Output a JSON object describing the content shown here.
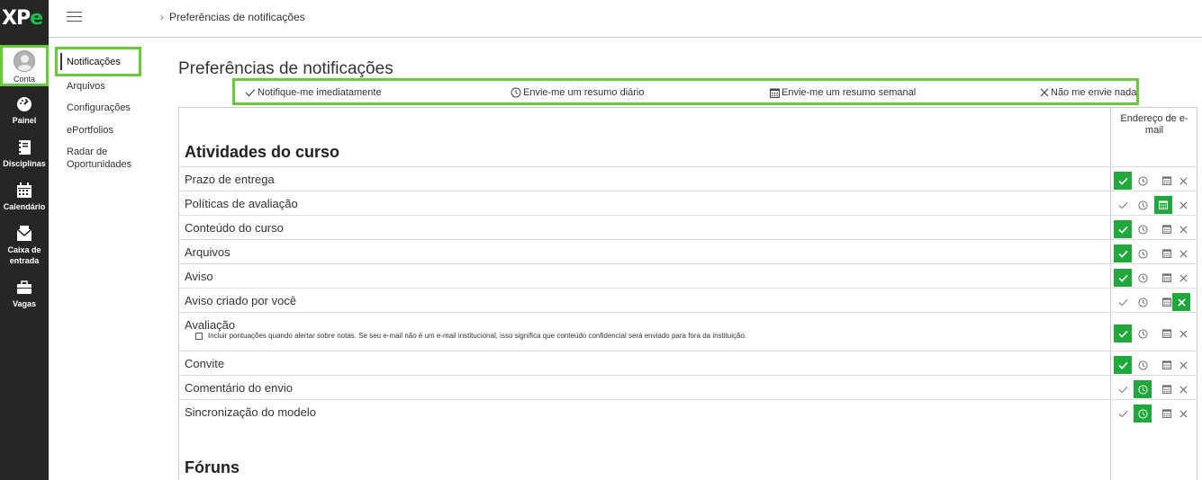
{
  "brand": {
    "logo_main": "XP",
    "logo_accent": "e"
  },
  "rail": {
    "account": "Conta",
    "items": [
      {
        "label": "Painel",
        "icon": "dashboard-icon"
      },
      {
        "label": "Disciplinas",
        "icon": "notebook-icon"
      },
      {
        "label": "Calendário",
        "icon": "calendar-icon"
      },
      {
        "label": "Caixa de entrada",
        "icon": "inbox-icon"
      },
      {
        "label": "Vagas",
        "icon": "briefcase-icon"
      }
    ]
  },
  "breadcrumb": {
    "current": "Preferências de notificações"
  },
  "subnav": {
    "active": "Notificações",
    "items": [
      "Arquivos",
      "Configurações",
      "ePortfolios",
      "Radar de Oportunidades"
    ]
  },
  "page": {
    "title": "Preferências de notificações"
  },
  "legend": {
    "immediate": "Notifique-me imediatamente",
    "daily": "Envie-me um resumo diário",
    "weekly": "Envie-me um resumo semanal",
    "none": "Não me envie nada"
  },
  "table": {
    "column_header": "Endereço de e-mail",
    "sections": {
      "course": "Atividades do curso",
      "forums": "Fóruns"
    },
    "rows": [
      {
        "label": "Prazo de entrega",
        "selected": "immediate"
      },
      {
        "label": "Políticas de avaliação",
        "selected": "weekly"
      },
      {
        "label": "Conteúdo do curso",
        "selected": "immediate"
      },
      {
        "label": "Arquivos",
        "selected": "immediate"
      },
      {
        "label": "Aviso",
        "selected": "immediate"
      },
      {
        "label": "Aviso criado por você",
        "selected": "none"
      },
      {
        "label": "Avaliação",
        "selected": "immediate",
        "note": "Incluir pontuações quando alertar sobre notas. Se seu e-mail não é um e-mail institucional, isso significa que conteúdo confidencial será enviado para fora da instituição.",
        "note_checked": false
      },
      {
        "label": "Convite",
        "selected": "immediate"
      },
      {
        "label": "Comentário do envio",
        "selected": "daily"
      },
      {
        "label": "Sincronização do modelo",
        "selected": "daily"
      }
    ]
  },
  "colors": {
    "accent_green": "#1fa93a",
    "highlight_green": "#66cc33",
    "rail_bg": "#262626"
  }
}
